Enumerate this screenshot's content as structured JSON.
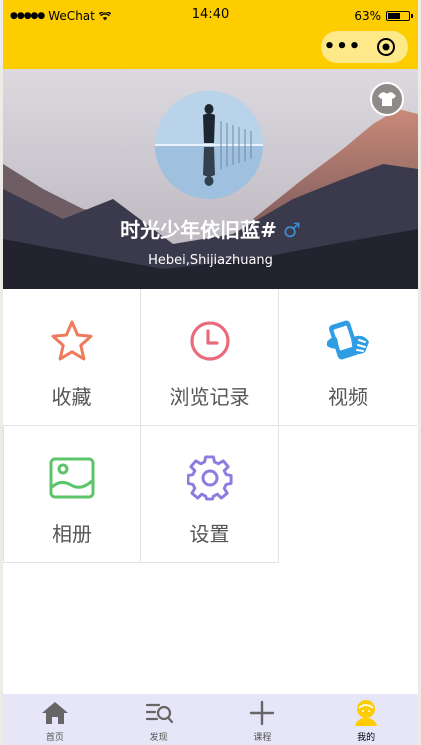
{
  "status_bar": {
    "carrier": "WeChat",
    "time": "14:40",
    "battery": "63%",
    "battery_level": 0.63
  },
  "profile": {
    "nickname": "时光少年依旧蓝#",
    "gender_symbol": "♂",
    "location": "Hebei,Shijiazhuang"
  },
  "menu": [
    {
      "label": "收藏",
      "icon": "star-icon",
      "color": "#ef7a5c"
    },
    {
      "label": "浏览记录",
      "icon": "clock-icon",
      "color": "#e86b7c"
    },
    {
      "label": "视频",
      "icon": "phone-video-icon",
      "color": "#2f9de3"
    },
    {
      "label": "相册",
      "icon": "image-icon",
      "color": "#5cc46a"
    },
    {
      "label": "设置",
      "icon": "gear-icon",
      "color": "#8a7de0"
    }
  ],
  "tabs": [
    {
      "label": "首页",
      "icon": "home-icon"
    },
    {
      "label": "发现",
      "icon": "discover-icon"
    },
    {
      "label": "课程",
      "icon": "plus-icon"
    },
    {
      "label": "我的",
      "icon": "user-icon"
    }
  ],
  "colors": {
    "brand_yellow": "#fdcd00",
    "tabbar_bg": "#e6e6f8"
  }
}
